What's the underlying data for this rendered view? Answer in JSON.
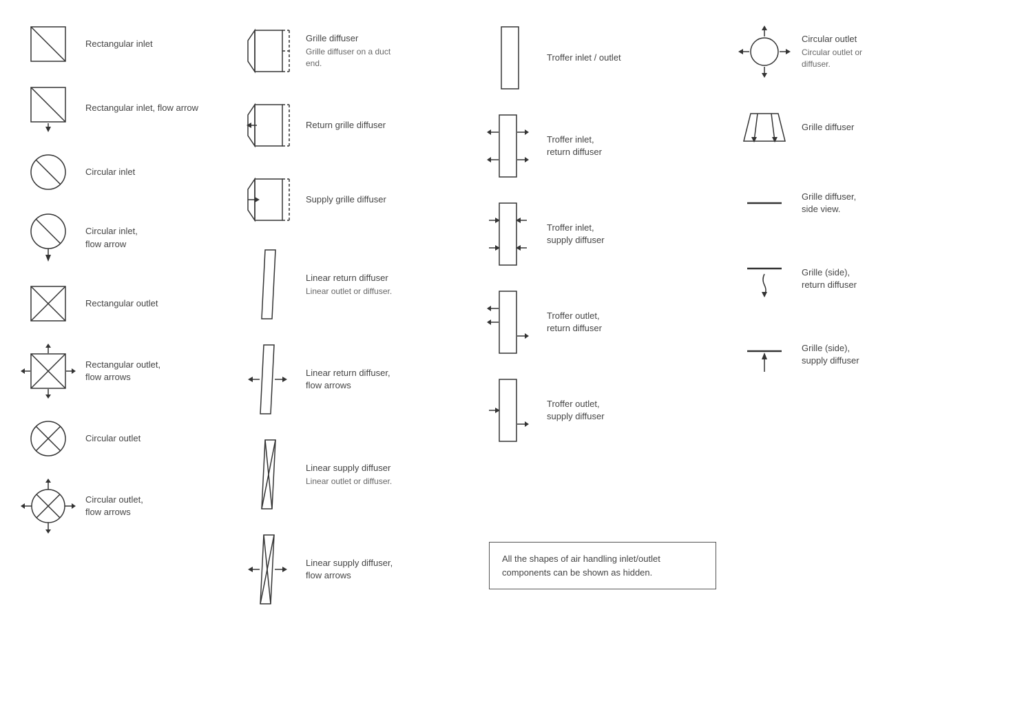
{
  "col1": {
    "items": [
      {
        "id": "rect-inlet",
        "label": "Rectangular inlet"
      },
      {
        "id": "rect-inlet-arrow",
        "label": "Rectangular inlet, flow arrow"
      },
      {
        "id": "circ-inlet",
        "label": "Circular inlet"
      },
      {
        "id": "circ-inlet-arrow",
        "label": "Circular inlet,\nflow arrow"
      },
      {
        "id": "rect-outlet",
        "label": "Rectangular outlet"
      },
      {
        "id": "rect-outlet-arrows",
        "label": "Rectangular outlet,\nflow arrows"
      },
      {
        "id": "circ-outlet",
        "label": "Circular outlet"
      },
      {
        "id": "circ-outlet-arrows",
        "label": "Circular outlet,\nflow arrows"
      }
    ]
  },
  "col2": {
    "items": [
      {
        "id": "grille-diffuser",
        "label": "Grille diffuser",
        "sub": "Grille diffuser on a duct end."
      },
      {
        "id": "return-grille-diffuser",
        "label": "Return grille diffuser"
      },
      {
        "id": "supply-grille-diffuser",
        "label": "Supply grille diffuser"
      },
      {
        "id": "linear-return-diffuser",
        "label": "Linear return diffuser",
        "sub": "Linear outlet or diffuser."
      },
      {
        "id": "linear-return-diffuser-arrows",
        "label": "Linear return diffuser,\nflow arrows"
      },
      {
        "id": "linear-supply-diffuser",
        "label": "Linear supply diffuser",
        "sub": "Linear outlet or diffuser."
      },
      {
        "id": "linear-supply-diffuser-arrows",
        "label": "Linear supply diffuser,\nflow arrows"
      }
    ]
  },
  "col3": {
    "items": [
      {
        "id": "troffer-inlet-outlet",
        "label": "Troffer inlet / outlet"
      },
      {
        "id": "troffer-inlet-return",
        "label": "Troffer inlet,\nreturn diffuser"
      },
      {
        "id": "troffer-inlet-supply",
        "label": "Troffer inlet,\nsupply diffuser"
      },
      {
        "id": "troffer-outlet-return",
        "label": "Troffer outlet,\nreturn diffuser"
      },
      {
        "id": "troffer-outlet-supply",
        "label": "Troffer outlet,\nsupply diffuser"
      }
    ],
    "notice": "All the shapes of air handling inlet/outlet components can be shown as hidden."
  },
  "col4": {
    "items": [
      {
        "id": "circ-outlet-diff",
        "label": "Circular outlet",
        "sub": "Circular outlet or diffuser."
      },
      {
        "id": "grille-diffuser-2",
        "label": "Grille diffuser"
      },
      {
        "id": "grille-diffuser-side",
        "label": "Grille diffuser,\nside view."
      },
      {
        "id": "grille-side-return",
        "label": "Grille (side),\nreturn diffuser"
      },
      {
        "id": "grille-side-supply",
        "label": "Grille (side),\nsupply diffuser"
      }
    ]
  }
}
